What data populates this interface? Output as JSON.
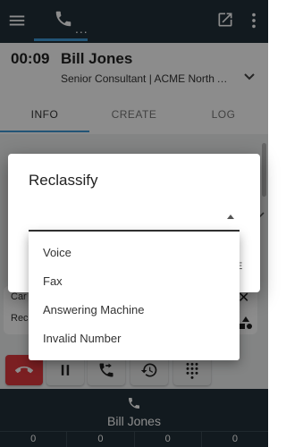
{
  "topbar": {
    "icons": [
      "menu-icon",
      "phone-icon",
      "external-link-icon",
      "more-vert-icon"
    ],
    "phone_dots": "..."
  },
  "call": {
    "timer": "00:09",
    "name": "Bill Jones",
    "title": "Senior Consultant | ACME North A..."
  },
  "tabs": [
    {
      "label": "INFO"
    },
    {
      "label": "CREATE"
    },
    {
      "label": "LOG"
    }
  ],
  "background": {
    "row1": "Car",
    "row2": "Rec"
  },
  "actions": {
    "icons": [
      "hangup-icon",
      "pause-icon",
      "transfer-icon",
      "history-icon",
      "dialpad-icon"
    ]
  },
  "bottom": {
    "name": "Bill Jones",
    "counts": [
      "0",
      "0",
      "0",
      "0"
    ]
  },
  "dialog": {
    "title": "Reclassify",
    "selected": "",
    "options": [
      "Voice",
      "Fax",
      "Answering Machine",
      "Invalid Number"
    ],
    "peek": "E"
  },
  "colors": {
    "bar": "#22313a",
    "accent": "#3f9ad8",
    "hangup": "#e0393e"
  }
}
